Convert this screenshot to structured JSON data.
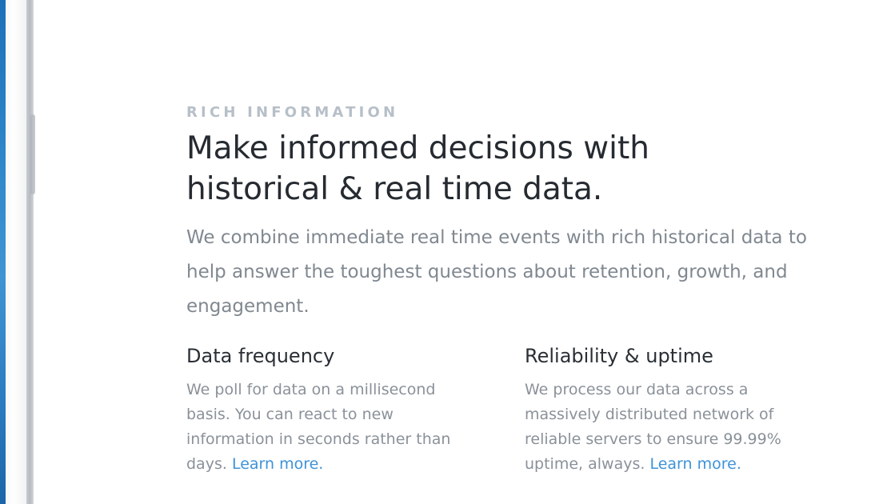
{
  "section": {
    "eyebrow": "RICH INFORMATION",
    "headline": "Make informed decisions with historical & real time data.",
    "intro": "We combine immediate real time events with rich historical data to help answer the toughest questions about retention, growth, and engagement."
  },
  "features": [
    {
      "title": "Data frequency",
      "body": "We poll for data on a millisecond basis. You can react to new information in seconds rather than days.",
      "link_label": "Learn more."
    },
    {
      "title": "Reliability & uptime",
      "body": "We process our data across a massively distributed network of reliable servers to ensure 99.99% uptime, always.",
      "link_label": "Learn more."
    }
  ],
  "colors": {
    "eyebrow": "#b7bfc8",
    "headline": "#262b31",
    "body": "#808890",
    "link": "#3e93d8",
    "device_screen": "#2d86c9"
  }
}
